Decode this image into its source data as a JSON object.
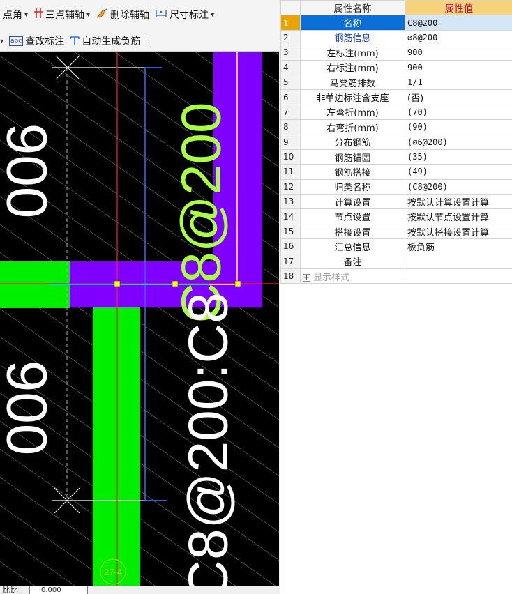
{
  "toolbar": {
    "row1": [
      {
        "label": "点角",
        "caret": "▾"
      },
      {
        "label": "三点辅轴",
        "caret": "▾"
      },
      {
        "label": "删除辅轴"
      },
      {
        "label": "尺寸标注",
        "caret": "▾"
      }
    ],
    "row2": [
      {
        "label": "查改标注"
      },
      {
        "label": "自动生成负筋"
      }
    ],
    "row2_lead_caret": "▾",
    "abc_badge": "abc"
  },
  "canvas": {
    "labels": {
      "upper_left_900": "900",
      "lower_left_900": "900",
      "right_vertical": "C8@200",
      "bottom_vertical": "C8@200:C8",
      "circle_tag": "27-4"
    },
    "colors": {
      "background": "#000000",
      "slab_purple": "#8000ff",
      "rebar_green": "#00ee00",
      "label_yellowgreen": "#aaff44",
      "axis_red": "#ff2020",
      "axis_blue": "#2a6bff",
      "axis_cyan": "#00d0ff",
      "hatch": "#bdbdbd"
    }
  },
  "status": {
    "label": "比比",
    "value": "0.000"
  },
  "props": {
    "headers": {
      "name": "属性名称",
      "value": "属性值"
    },
    "rows": [
      {
        "n": "1",
        "name": "名称",
        "value": "C8@200",
        "selected": true
      },
      {
        "n": "2",
        "name": "钢筋信息",
        "value": "⌀8@200",
        "blue": true
      },
      {
        "n": "3",
        "name": "左标注(mm)",
        "value": "900"
      },
      {
        "n": "4",
        "name": "右标注(mm)",
        "value": "900"
      },
      {
        "n": "5",
        "name": "马凳筋排数",
        "value": "1/1"
      },
      {
        "n": "6",
        "name": "非单边标注含支座",
        "value": "(否)",
        "cjk": true
      },
      {
        "n": "7",
        "name": "左弯折(mm)",
        "value": "(70)"
      },
      {
        "n": "8",
        "name": "右弯折(mm)",
        "value": "(90)"
      },
      {
        "n": "9",
        "name": "分布钢筋",
        "value": "(⌀6@200)"
      },
      {
        "n": "10",
        "name": "钢筋锚固",
        "value": "(35)"
      },
      {
        "n": "11",
        "name": "钢筋搭接",
        "value": "(49)"
      },
      {
        "n": "12",
        "name": "归类名称",
        "value": "(C8@200)"
      },
      {
        "n": "13",
        "name": "计算设置",
        "value": "按默认计算设置计算",
        "cjk": true
      },
      {
        "n": "14",
        "name": "节点设置",
        "value": "按默认节点设置计算",
        "cjk": true
      },
      {
        "n": "15",
        "name": "搭接设置",
        "value": "按默认搭接设置计算",
        "cjk": true
      },
      {
        "n": "16",
        "name": "汇总信息",
        "value": "板负筋",
        "cjk": true
      },
      {
        "n": "17",
        "name": "备注",
        "value": ""
      },
      {
        "n": "18",
        "name": "显示样式",
        "value": "",
        "expander": "+",
        "grey": true
      }
    ]
  }
}
